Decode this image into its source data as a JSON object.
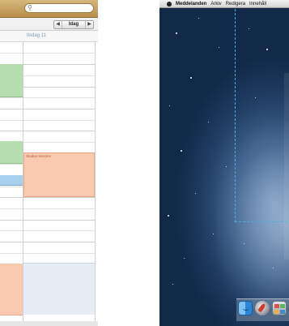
{
  "calendar": {
    "day_header": "tisdag 11",
    "nav": {
      "prev": "◀",
      "today": "Idag",
      "next": "▶"
    },
    "event_title": "Studiar lessons",
    "search_icon": "search-icon"
  },
  "desktop": {
    "menubar": {
      "apple_icon": "apple-icon",
      "items": [
        "Meddelanden",
        "Arkiv",
        "Redigera",
        "Innehåll"
      ]
    },
    "dock": {
      "icons": [
        "finder-icon",
        "launchpad-icon",
        "app-store-icon"
      ]
    }
  },
  "colors": {
    "event_green": "#b8ddb1",
    "event_blue": "#a8cfee",
    "event_salmon": "#f9c9b0",
    "drop_outline": "#3fb3e8",
    "toolbar_wood": "#c9a25f"
  }
}
